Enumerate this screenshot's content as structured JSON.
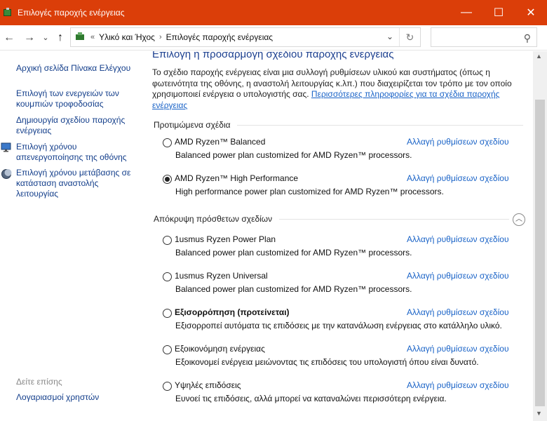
{
  "window": {
    "title": "Επιλογές παροχής ενέργειας",
    "controls": {
      "minimize": "—",
      "maximize": "☐",
      "close": "✕"
    }
  },
  "nav": {
    "back": "←",
    "forward": "→",
    "recent": "⌄",
    "up": "↑",
    "breadcrumb": [
      "Υλικό και Ήχος",
      "Επιλογές παροχής ενέργειας"
    ],
    "overflow": "«",
    "sep": "›",
    "dropdown": "⌄",
    "refresh": "↻",
    "search_icon": "⚲"
  },
  "sidebar": {
    "items": [
      {
        "label": "Αρχική σελίδα Πίνακα Ελέγχου",
        "icon": ""
      },
      {
        "label": "Επιλογή των ενεργειών των κουμπιών τροφοδοσίας",
        "icon": ""
      },
      {
        "label": "Δημιουργία σχεδίου παροχής ενέργειας",
        "icon": ""
      },
      {
        "label": "Επιλογή χρόνου απενεργοποίησης της οθόνης",
        "icon": "monitor-icon"
      },
      {
        "label": "Επιλογή χρόνου μετάβασης σε κατάσταση αναστολής λειτουργίας",
        "icon": "moon-icon"
      }
    ],
    "see_also": "Δείτε επίσης",
    "see_also_items": [
      {
        "label": "Λογαριασμοί χρηστών"
      }
    ]
  },
  "main": {
    "heading": "Επιλογή ή προσαρμογή σχεδίου παροχής ενέργειας",
    "intro": "Το σχέδιο παροχής ενέργειας είναι μια συλλογή ρυθμίσεων υλικού και συστήματος (όπως η φωτεινότητα της οθόνης, η αναστολή λειτουργίας κ.λπ.) που διαχειρίζεται τον τρόπο με τον οποίο χρησιμοποιεί ενέργεια ο υπολογιστής σας. ",
    "intro_link": "Περισσότερες πληροφορίες για τα σχέδια παροχής ενέργειας",
    "preferred_title": "Προτιμώμενα σχέδια",
    "hidden_title": "Απόκρυψη πρόσθετων σχεδίων",
    "collapse_icon": "︿",
    "change_link": "Αλλαγή ρυθμίσεων σχεδίου",
    "preferred": [
      {
        "name": "AMD Ryzen™ Balanced",
        "desc": "Balanced power plan customized for AMD Ryzen™ processors.",
        "selected": false
      },
      {
        "name": "AMD Ryzen™ High Performance",
        "desc": "High performance power plan customized for AMD Ryzen™ processors.",
        "selected": true
      }
    ],
    "hidden": [
      {
        "name": "1usmus Ryzen Power Plan",
        "desc": "Balanced power plan customized for AMD Ryzen™ processors.",
        "selected": false
      },
      {
        "name": "1usmus Ryzen Universal",
        "desc": "Balanced power plan customized for AMD Ryzen™ processors.",
        "selected": false
      },
      {
        "name": "Εξισορρόπηση (προτείνεται)",
        "desc": "Εξισορροπεί αυτόματα τις επιδόσεις με την κατανάλωση ενέργειας στο κατάλληλο υλικό.",
        "selected": false,
        "bold": true
      },
      {
        "name": "Εξοικονόμηση ενέργειας",
        "desc": "Εξοικονομεί ενέργεια μειώνοντας τις επιδόσεις του υπολογιστή όπου είναι δυνατό.",
        "selected": false
      },
      {
        "name": "Υψηλές επιδόσεις",
        "desc": "Ευνοεί τις επιδόσεις, αλλά μπορεί να καταναλώνει περισσότερη ενέργεια.",
        "selected": false
      }
    ]
  },
  "colors": {
    "titlebar": "#db3e09",
    "link": "#1a63c7",
    "heading": "#1b3f8f"
  }
}
